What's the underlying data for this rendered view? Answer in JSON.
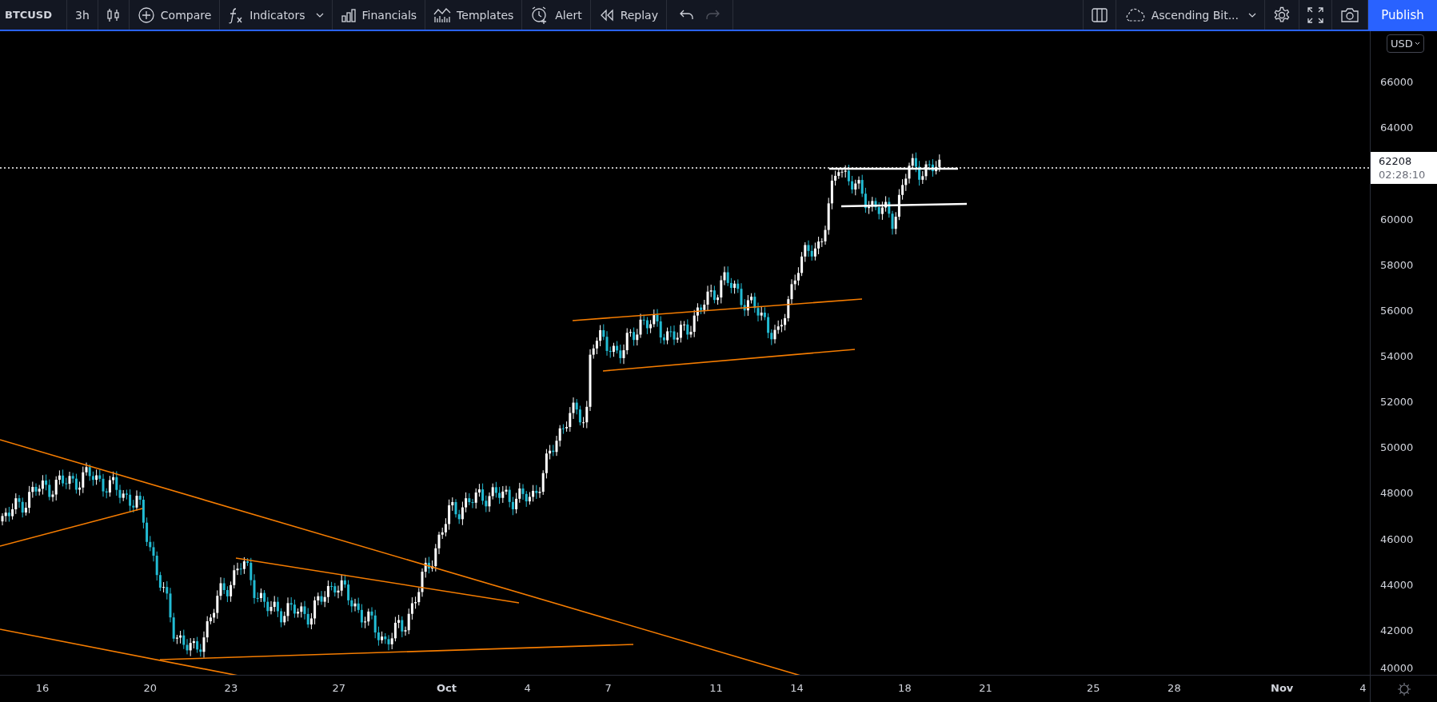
{
  "toolbar": {
    "symbol": "BTCUSD",
    "interval": "3h",
    "left_buttons": [
      {
        "kind": "compare",
        "label": "Compare"
      },
      {
        "kind": "indicators",
        "label": "Indicators"
      },
      {
        "kind": "financials",
        "label": "Financials"
      },
      {
        "kind": "templates",
        "label": "Templates"
      },
      {
        "kind": "alert",
        "label": "Alert"
      },
      {
        "kind": "replay",
        "label": "Replay"
      }
    ],
    "layout_name": "Ascending Bit...",
    "publish": "Publish"
  },
  "price_axis": {
    "currency": "USD",
    "labels": [
      "66000",
      "64000",
      "60000",
      "58000",
      "56000",
      "54000",
      "52000",
      "50000",
      "48000",
      "46000",
      "44000",
      "42000",
      "40000"
    ],
    "last_price": "62208",
    "countdown": "02:28:10"
  },
  "time_axis": {
    "labels": [
      {
        "text": "16",
        "kind": "day"
      },
      {
        "text": "20",
        "kind": "day"
      },
      {
        "text": "23",
        "kind": "day"
      },
      {
        "text": "27",
        "kind": "day"
      },
      {
        "text": "Oct",
        "kind": "month"
      },
      {
        "text": "4",
        "kind": "day"
      },
      {
        "text": "7",
        "kind": "day"
      },
      {
        "text": "11",
        "kind": "day"
      },
      {
        "text": "14",
        "kind": "day"
      },
      {
        "text": "18",
        "kind": "day"
      },
      {
        "text": "21",
        "kind": "day"
      },
      {
        "text": "25",
        "kind": "day"
      },
      {
        "text": "28",
        "kind": "day"
      },
      {
        "text": "Nov",
        "kind": "month"
      },
      {
        "text": "4",
        "kind": "day"
      }
    ]
  }
}
